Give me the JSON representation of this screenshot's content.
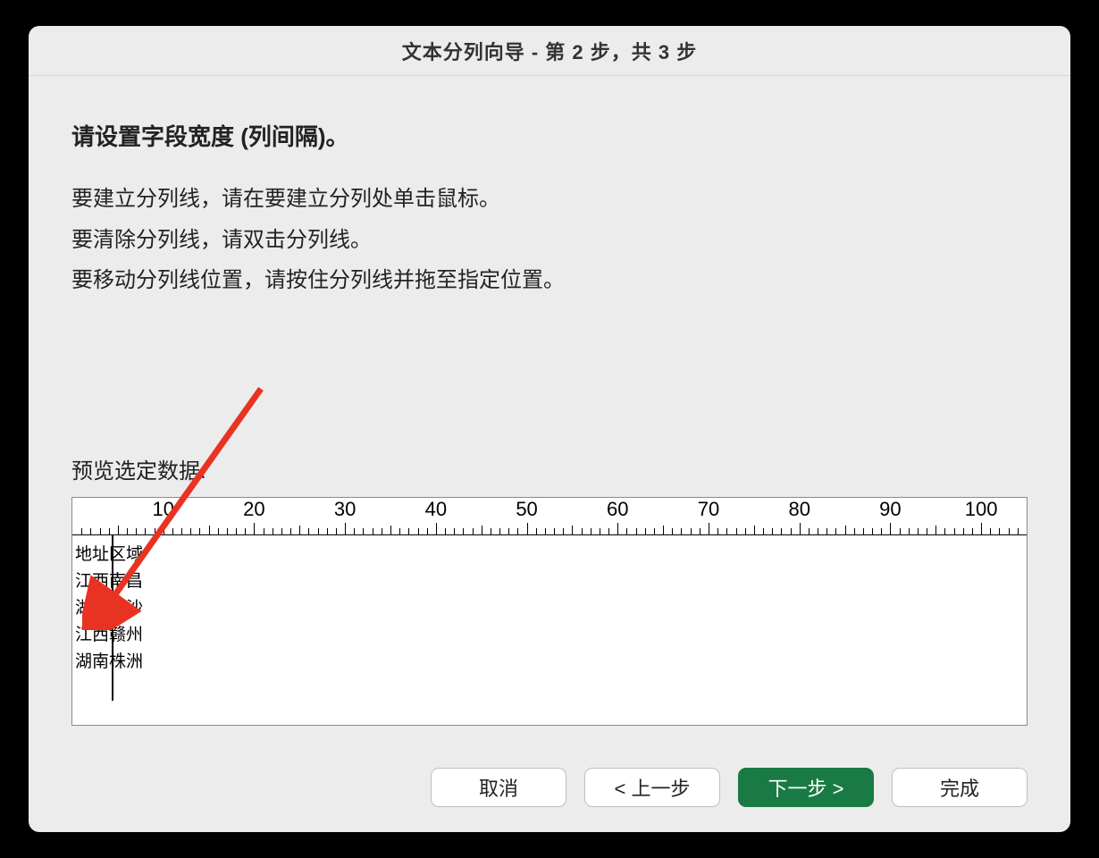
{
  "title": "文本分列向导 - 第 2 步，共 3 步",
  "heading": "请设置字段宽度 (列间隔)。",
  "instructions": {
    "line1": "要建立分列线，请在要建立分列处单击鼠标。",
    "line2": "要清除分列线，请双击分列线。",
    "line3": "要移动分列线位置，请按住分列线并拖至指定位置。"
  },
  "preview_label": "预览选定数据:",
  "ruler": {
    "labels": [
      "10",
      "20",
      "30",
      "40",
      "50",
      "60",
      "70",
      "80",
      "90",
      "100"
    ]
  },
  "break_position_chars": 2,
  "data_rows": [
    {
      "col1": "地址",
      "col2": "区域"
    },
    {
      "col1": "江西",
      "col2": "南昌"
    },
    {
      "col1": "湖南",
      "col2": "长沙"
    },
    {
      "col1": "江西",
      "col2": "赣州"
    },
    {
      "col1": "湖南",
      "col2": "株洲"
    }
  ],
  "buttons": {
    "cancel": "取消",
    "back": "< 上一步",
    "next": "下一步 >",
    "finish": "完成"
  }
}
